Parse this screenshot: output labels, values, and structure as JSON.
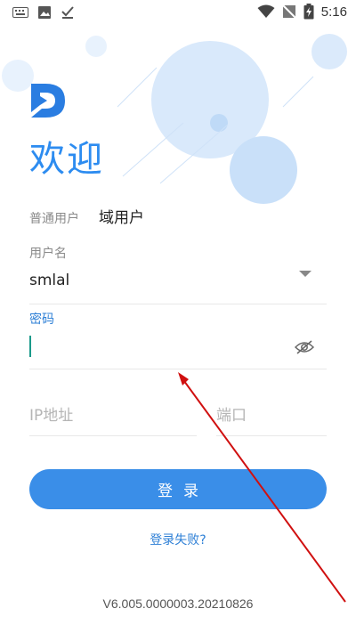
{
  "status_bar": {
    "time": "5:16",
    "icons": [
      "keyboard-icon",
      "image-icon",
      "check-download-icon",
      "wifi-icon",
      "no-sim-icon",
      "battery-charging-icon"
    ]
  },
  "header": {
    "welcome": "欢迎"
  },
  "user_type": {
    "normal_label": "普通用户",
    "domain_label": "域用户"
  },
  "username": {
    "label": "用户名",
    "value": "smlal"
  },
  "password": {
    "label": "密码",
    "value": ""
  },
  "server": {
    "ip_placeholder": "IP地址",
    "port_placeholder": "端口"
  },
  "actions": {
    "login_label": "登录",
    "forgot_label": "登录失败?"
  },
  "footer": {
    "version": "V6.005.0000003.20210826"
  },
  "colors": {
    "accent": "#2d8cf0",
    "button": "#3a8ee8",
    "annotation": "#d01010"
  }
}
